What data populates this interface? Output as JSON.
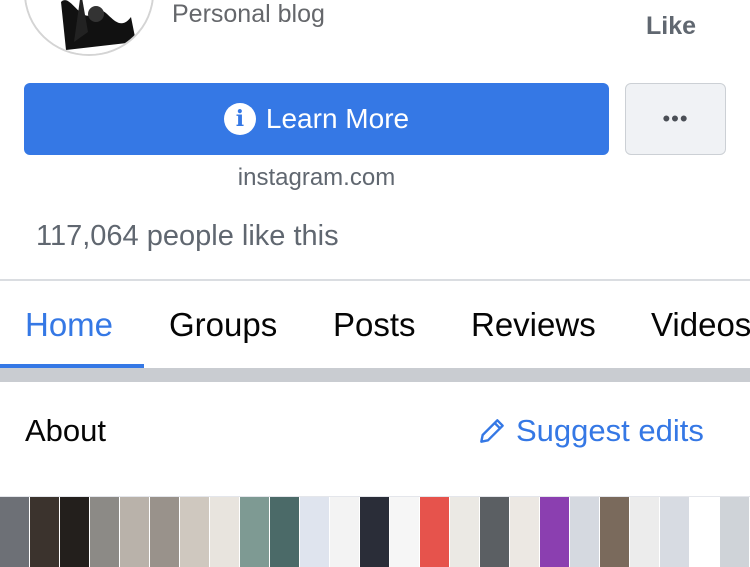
{
  "header": {
    "category": "Personal blog",
    "like_label": "Like"
  },
  "actions": {
    "learn_more_label": "Learn More",
    "info_icon_glyph": "i",
    "more_label": "•••"
  },
  "website": "instagram.com",
  "likes_text": "117,064 people like this",
  "tabs": [
    {
      "label": "Home",
      "active": true
    },
    {
      "label": "Groups",
      "active": false
    },
    {
      "label": "Posts",
      "active": false
    },
    {
      "label": "Reviews",
      "active": false
    },
    {
      "label": "Videos",
      "active": false
    }
  ],
  "about": {
    "title": "About",
    "suggest_edits_label": "Suggest edits"
  },
  "colors": {
    "accent": "#3578e5",
    "secondary_text": "#606770",
    "band": "#c9ccd1"
  },
  "thumbnails": [
    {
      "color": "#6d7076"
    },
    {
      "color": "#3b332d"
    },
    {
      "color": "#231f1c"
    },
    {
      "color": "#8c8a86"
    },
    {
      "color": "#b9b2aa"
    },
    {
      "color": "#99928b"
    },
    {
      "color": "#cfc8bf"
    },
    {
      "color": "#e8e4de"
    },
    {
      "color": "#7e9a93"
    },
    {
      "color": "#4b6a68"
    },
    {
      "color": "#dfe4ee"
    },
    {
      "color": "#f3f3f3"
    },
    {
      "color": "#2a2d38"
    },
    {
      "color": "#f6f6f6"
    },
    {
      "color": "#e6534c"
    },
    {
      "color": "#ebe9e4"
    },
    {
      "color": "#5b5f63"
    },
    {
      "color": "#ece8e3"
    },
    {
      "color": "#8b3fb0"
    },
    {
      "color": "#d5d9e0"
    },
    {
      "color": "#7a6a5c"
    },
    {
      "color": "#ececec"
    },
    {
      "color": "#d7dbe2"
    },
    {
      "color": "#ffffff"
    },
    {
      "color": "#cfd3d8"
    }
  ]
}
